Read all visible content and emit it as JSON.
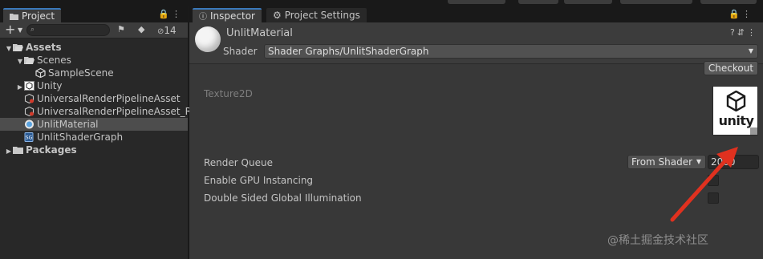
{
  "project_panel": {
    "tab_label": "Project",
    "hidden_count": "14",
    "tree": [
      {
        "label": "Assets",
        "level": 0,
        "expanded": true,
        "bold": true,
        "icon": "folder-open-icon"
      },
      {
        "label": "Scenes",
        "level": 1,
        "expanded": true,
        "bold": false,
        "icon": "folder-open-icon"
      },
      {
        "label": "SampleScene",
        "level": 2,
        "expanded": null,
        "bold": false,
        "icon": "unity-scene-icon"
      },
      {
        "label": "Unity",
        "level": 1,
        "expanded": false,
        "bold": false,
        "icon": "texture-icon"
      },
      {
        "label": "UniversalRenderPipelineAsset",
        "level": 1,
        "expanded": null,
        "bold": false,
        "icon": "urp-asset-icon"
      },
      {
        "label": "UniversalRenderPipelineAsset_R",
        "level": 1,
        "expanded": null,
        "bold": false,
        "icon": "urp-asset-icon"
      },
      {
        "label": "UnlitMaterial",
        "level": 1,
        "expanded": null,
        "bold": false,
        "icon": "material-icon",
        "selected": true
      },
      {
        "label": "UnlitShaderGraph",
        "level": 1,
        "expanded": null,
        "bold": false,
        "icon": "shadergraph-icon"
      },
      {
        "label": "Packages",
        "level": 0,
        "expanded": false,
        "bold": true,
        "icon": "folder-icon"
      }
    ]
  },
  "inspector": {
    "tabs": [
      {
        "label": "Inspector",
        "active": true,
        "icon": "info-icon"
      },
      {
        "label": "Project Settings",
        "active": false,
        "icon": "gear-icon"
      }
    ],
    "material_name": "UnlitMaterial",
    "shader_label": "Shader",
    "shader_value": "Shader Graphs/UnlitShaderGraph",
    "checkout_label": "Checkout",
    "texture_label": "Texture2D",
    "texture_preview_text": "unity",
    "render_queue_label": "Render Queue",
    "render_queue_mode": "From Shader",
    "render_queue_value": "2000",
    "gpu_instancing_label": "Enable GPU Instancing",
    "double_sided_gi_label": "Double Sided Global Illumination"
  },
  "watermark": "@稀土掘金技术社区",
  "colors": {
    "accent_tab": "#3a79bb",
    "selection": "#4d4d4d",
    "annotation_arrow": "#e0311f"
  }
}
